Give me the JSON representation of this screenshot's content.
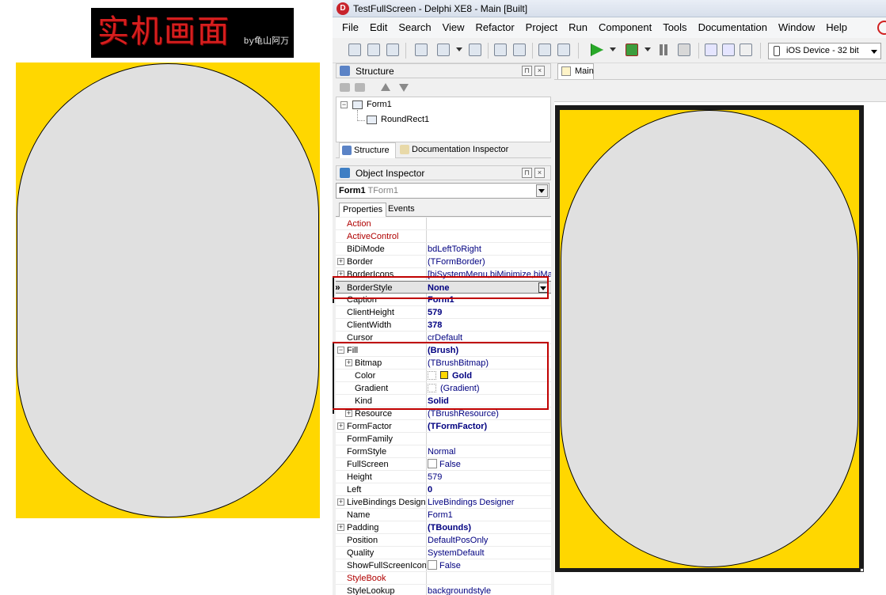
{
  "logo": {
    "text_cjk": "实机画面",
    "text_by": "by龟山阿万"
  },
  "window": {
    "title": "TestFullScreen - Delphi XE8 - Main [Built]"
  },
  "menu": [
    "File",
    "Edit",
    "Search",
    "View",
    "Refactor",
    "Project",
    "Run",
    "Component",
    "Tools",
    "Documentation",
    "Window",
    "Help"
  ],
  "toolbar": {
    "device": "iOS Device - 32 bit"
  },
  "structure": {
    "title": "Structure",
    "tree": [
      {
        "label": "Form1"
      },
      {
        "label": "RoundRect1"
      }
    ],
    "tabs": [
      "Structure",
      "Documentation Inspector"
    ]
  },
  "inspector": {
    "title": "Object Inspector",
    "selected_object": "Form1",
    "selected_type": "TForm1",
    "tabs": [
      "Properties",
      "Events"
    ],
    "properties": [
      {
        "name": "Action",
        "value": "",
        "red": true
      },
      {
        "name": "ActiveControl",
        "value": "",
        "red": true
      },
      {
        "name": "BiDiMode",
        "value": "bdLeftToRight"
      },
      {
        "name": "Border",
        "value": "(TFormBorder)",
        "expander": "+"
      },
      {
        "name": "BorderIcons",
        "value": "[biSystemMenu,biMinimize,biMax",
        "expander": "+"
      },
      {
        "name": "BorderStyle",
        "value": "None",
        "bold": true,
        "selected": true
      },
      {
        "name": "Caption",
        "value": "Form1",
        "bold": true
      },
      {
        "name": "ClientHeight",
        "value": "579",
        "bold": true
      },
      {
        "name": "ClientWidth",
        "value": "378",
        "bold": true
      },
      {
        "name": "Cursor",
        "value": "crDefault"
      },
      {
        "name": "Fill",
        "value": "(Brush)",
        "bold": true,
        "expander": "−"
      },
      {
        "name": "Bitmap",
        "value": "(TBrushBitmap)",
        "expander": "+",
        "indent": true
      },
      {
        "name": "Color",
        "value": "Gold",
        "bold": true,
        "indent": true,
        "swatch": "#FFD700"
      },
      {
        "name": "Gradient",
        "value": "(Gradient)",
        "indent": true,
        "mini": true
      },
      {
        "name": "Kind",
        "value": "Solid",
        "bold": true,
        "indent": true
      },
      {
        "name": "Resource",
        "value": "(TBrushResource)",
        "expander": "+",
        "indent": true
      },
      {
        "name": "FormFactor",
        "value": "(TFormFactor)",
        "bold": true,
        "expander": "+"
      },
      {
        "name": "FormFamily",
        "value": ""
      },
      {
        "name": "FormStyle",
        "value": "Normal"
      },
      {
        "name": "FullScreen",
        "value": "False",
        "checkbox": true
      },
      {
        "name": "Height",
        "value": "579"
      },
      {
        "name": "Left",
        "value": "0",
        "bold": true
      },
      {
        "name": "LiveBindings Designer",
        "value": "LiveBindings Designer",
        "expander": "+"
      },
      {
        "name": "Name",
        "value": "Form1"
      },
      {
        "name": "Padding",
        "value": "(TBounds)",
        "bold": true,
        "expander": "+"
      },
      {
        "name": "Position",
        "value": "DefaultPosOnly"
      },
      {
        "name": "Quality",
        "value": "SystemDefault"
      },
      {
        "name": "ShowFullScreenIcon",
        "value": "False",
        "checkbox": true
      },
      {
        "name": "StyleBook",
        "value": "",
        "red": true
      },
      {
        "name": "StyleLookup",
        "value": "backgroundstyle"
      }
    ]
  },
  "designer": {
    "tab": "Main"
  },
  "colors": {
    "fill": "#FFD700",
    "shape": "#E0E0E0",
    "highlight": "#C00000"
  }
}
